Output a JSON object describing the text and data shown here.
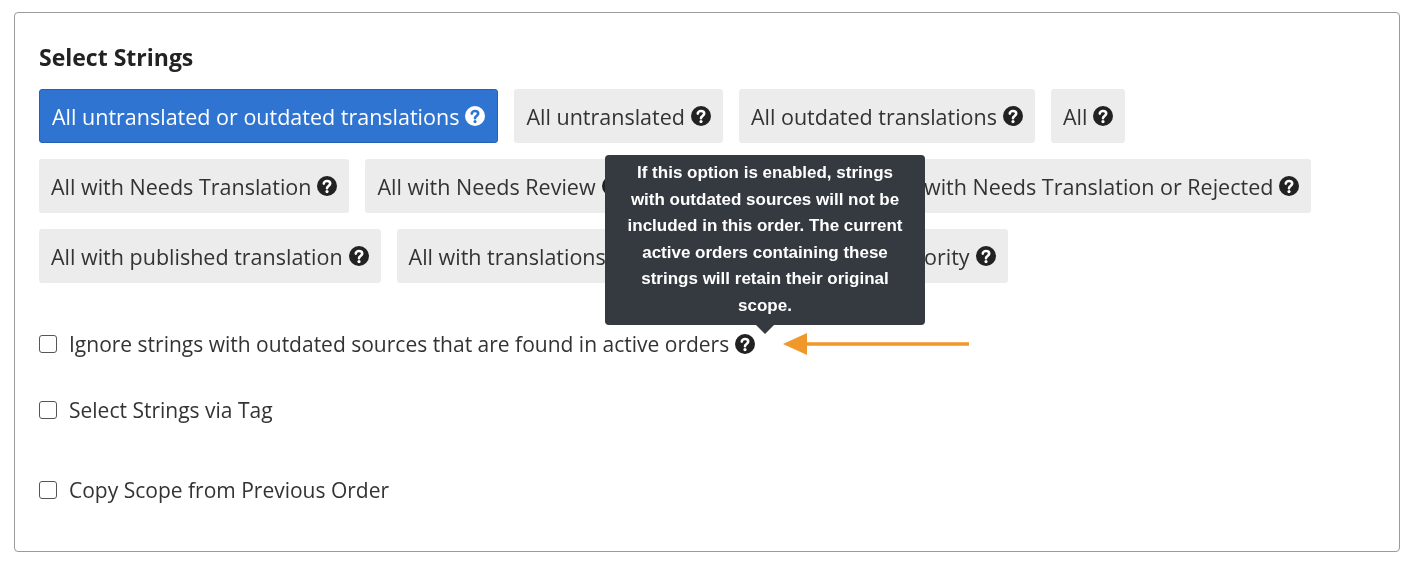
{
  "title": "Select Strings",
  "option_rows": [
    [
      {
        "label": "All untranslated or outdated translations",
        "selected": true,
        "icon": true
      },
      {
        "label": "All untranslated",
        "selected": false,
        "icon": true
      },
      {
        "label": "All outdated translations",
        "selected": false,
        "icon": true
      },
      {
        "label": "All",
        "selected": false,
        "icon": true
      }
    ],
    [
      {
        "label": "All with Needs Translation",
        "selected": false,
        "icon": true
      },
      {
        "label": "All with Needs Review",
        "selected": false,
        "icon": true,
        "covered": true
      },
      {
        "label": "with Needs Translation or Rejected",
        "selected": false,
        "icon": true,
        "covered": true
      }
    ],
    [
      {
        "label": "All with published translation",
        "selected": false,
        "icon": true
      },
      {
        "label": "All with translations",
        "selected": false,
        "icon": false,
        "covered": true
      },
      {
        "label": "ority",
        "selected": false,
        "icon": true,
        "covered": true
      }
    ]
  ],
  "checkboxes": [
    {
      "label": "Ignore strings with outdated sources that are found in active orders",
      "checked": false,
      "help": true,
      "arrow": true
    },
    {
      "label": "Select Strings via Tag",
      "checked": false,
      "help": false,
      "arrow": false
    },
    {
      "label": "Copy Scope from Previous Order",
      "checked": false,
      "help": false,
      "arrow": false
    }
  ],
  "tooltip": {
    "text": "If this option is enabled, strings with outdated sources will not be included in this order. The current active orders containing these strings will retain their original scope."
  }
}
